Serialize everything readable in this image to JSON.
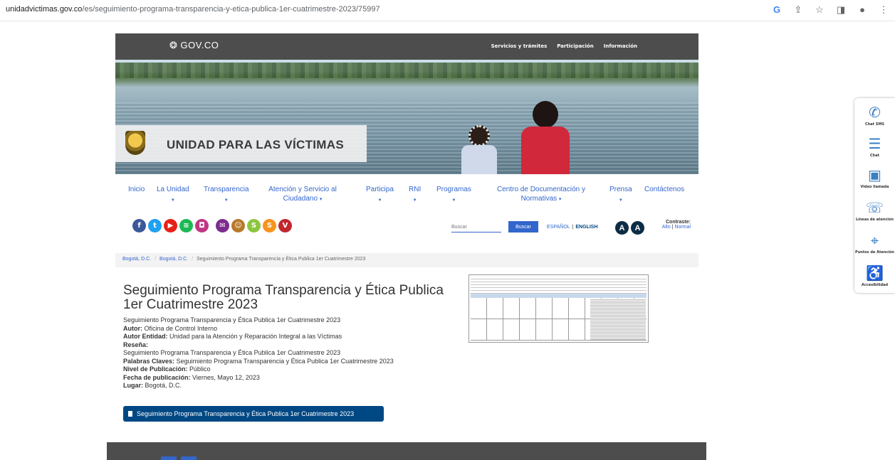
{
  "browser": {
    "url_host": "unidadvictimas.gov.co",
    "url_path": "/es/seguimiento-programa-transparencia-y-etica-publica-1er-cuatrimestre-2023/75997"
  },
  "gov_bar": {
    "logo": "GOV.CO",
    "links": [
      "Servicios y trámites",
      "Participación",
      "Información"
    ]
  },
  "brand": {
    "title": "UNIDAD PARA LAS VÍCTIMAS"
  },
  "nav": {
    "items": [
      {
        "label": "Inicio"
      },
      {
        "label": "La Unidad"
      },
      {
        "label": "Transparencia"
      },
      {
        "label": "Atención y Servicio al Ciudadano"
      },
      {
        "label": "Participa"
      },
      {
        "label": "RNI"
      },
      {
        "label": "Programas"
      },
      {
        "label": "Centro de Documentación y Normativas"
      },
      {
        "label": "Prensa"
      },
      {
        "label": "Contáctenos"
      }
    ]
  },
  "social": [
    {
      "icon": "facebook-icon",
      "glyph": "f",
      "color": "#3b5998"
    },
    {
      "icon": "twitter-icon",
      "glyph": "t",
      "color": "#1da1f2"
    },
    {
      "icon": "youtube-icon",
      "glyph": "▶",
      "color": "#e62117"
    },
    {
      "icon": "spotify-icon",
      "glyph": "≋",
      "color": "#1db954"
    },
    {
      "icon": "instagram-icon",
      "glyph": "◘",
      "color": "#c13584"
    },
    {
      "icon": "email-icon",
      "glyph": "✉",
      "color": "#7b2d8b"
    },
    {
      "icon": "community-icon",
      "glyph": "☺",
      "color": "#b8792a"
    },
    {
      "icon": "s-icon-1",
      "glyph": "S",
      "color": "#8cc63f"
    },
    {
      "icon": "s-icon-2",
      "glyph": "S",
      "color": "#f7941d"
    },
    {
      "icon": "v-icon",
      "glyph": "V",
      "color": "#c1272d"
    }
  ],
  "search": {
    "placeholder": "Buscar",
    "button": "Buscar"
  },
  "lang": {
    "es": "ESPAÑOL",
    "en": "ENGLISH"
  },
  "accessibility": {
    "a1": "A",
    "a2": "A"
  },
  "contrast": {
    "label": "Contraste:",
    "high": "Alto",
    "normal": "Normal"
  },
  "breadcrumb": [
    "Bogotá, D.C.",
    "Bogotá, D.C.",
    "Seguimiento Programa Transparencia y Ética Publica 1er Cuatrimestre 2023"
  ],
  "document": {
    "title": "Seguimiento Programa Transparencia y Ética Publica 1er Cuatrimestre 2023",
    "subtitle": "Seguimiento Programa Transparencia y Ética Publica 1er Cuatrimestre 2023",
    "autor_label": "Autor:",
    "autor": "Oficina de Control Interno",
    "entidad_label": "Autor Entidad:",
    "entidad": "Unidad para la Atención y Reparación Integral a las Víctimas",
    "resena_label": "Reseña:",
    "resena": "Seguimiento Programa Transparencia y Ética Publica 1er Cuatrimestre 2023",
    "palabras_label": "Palabras Claves:",
    "palabras": "Seguimiento Programa Transparencia y Ética Publica 1er Cuatrimestre 2023",
    "nivel_label": "Nivel de Publicación:",
    "nivel": "Público",
    "fecha_label": "Fecha de publicación:",
    "fecha": "Viernes, Mayo 12, 2023",
    "lugar_label": "Lugar:",
    "lugar": "Bogotá, D.C.",
    "download": "Seguimiento Programa Transparencia y Ética Publica 1er Cuatrimestre 2023"
  },
  "side_widget": [
    {
      "label": "Chat SMS",
      "icon": "chat-sms-icon",
      "glyph": "✆"
    },
    {
      "label": "Chat",
      "icon": "chat-icon",
      "glyph": "☰"
    },
    {
      "label": "Video llamada",
      "icon": "video-call-icon",
      "glyph": "▣"
    },
    {
      "label": "Líneas de atención",
      "icon": "phone-icon",
      "glyph": "☏"
    },
    {
      "label": "Puntos de Atención",
      "icon": "map-pin-icon",
      "glyph": "⌖"
    },
    {
      "label": "Accesibilidad",
      "icon": "accessibility-icon",
      "glyph": "♿"
    }
  ]
}
